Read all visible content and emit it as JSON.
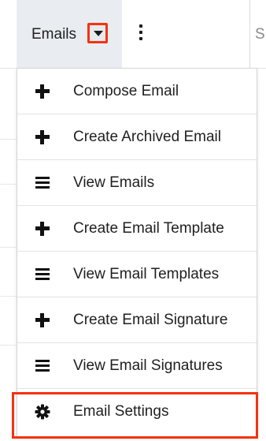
{
  "nav": {
    "active_tab": "Emails",
    "next_tab_partial": "S",
    "accent_color": "#f4320f"
  },
  "menu": {
    "items": [
      {
        "label": "Compose Email",
        "icon": "plus-icon"
      },
      {
        "label": "Create Archived Email",
        "icon": "plus-icon"
      },
      {
        "label": "View Emails",
        "icon": "list-icon"
      },
      {
        "label": "Create Email Template",
        "icon": "plus-icon"
      },
      {
        "label": "View Email Templates",
        "icon": "list-icon"
      },
      {
        "label": "Create Email Signature",
        "icon": "plus-icon"
      },
      {
        "label": "View Email Signatures",
        "icon": "list-icon"
      },
      {
        "label": "Email Settings",
        "icon": "gear-icon"
      }
    ]
  }
}
